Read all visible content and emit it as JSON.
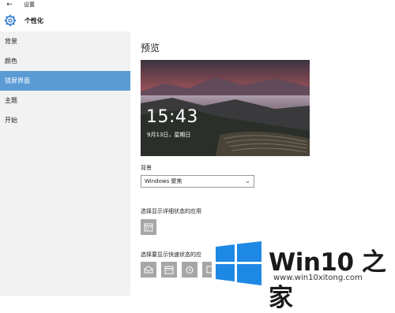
{
  "window": {
    "title": "设置",
    "back_icon": "back-arrow-icon"
  },
  "header": {
    "title": "个性化",
    "icon": "gear-icon"
  },
  "sidebar": {
    "items": [
      {
        "label": "背景",
        "active": false
      },
      {
        "label": "颜色",
        "active": false
      },
      {
        "label": "锁屏界面",
        "active": true
      },
      {
        "label": "主题",
        "active": false
      },
      {
        "label": "开始",
        "active": false
      }
    ]
  },
  "main": {
    "preview_title": "预览",
    "preview_time": "15:43",
    "preview_date": "9月13日，星期日",
    "background_label": "背景",
    "background_value": "Windows 聚焦",
    "detail_status_label": "选择显示详细状态的应用",
    "quick_status_label": "选择要显示快速状态的应"
  },
  "watermark": {
    "brand": "Win10 之家",
    "url": "www.win10xitong.com"
  },
  "colors": {
    "accent": "#5b9bd5",
    "sidebar_bg": "#f2f2f2",
    "app_tile": "#a6a6a6",
    "logo_blue": "#1e88e5"
  }
}
